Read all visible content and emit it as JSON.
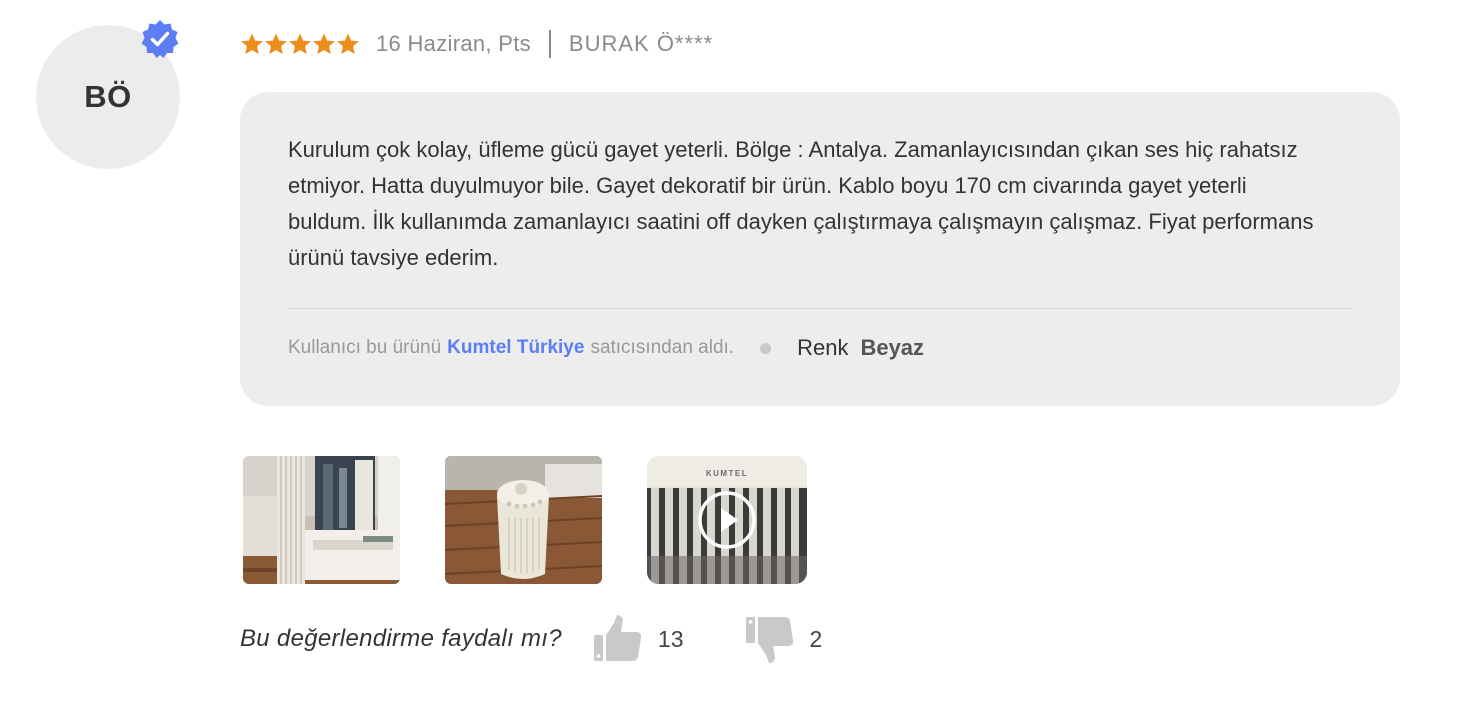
{
  "reviewer": {
    "initials": "BÖ",
    "name": "BURAK Ö****",
    "verified_icon": "verified-badge-icon"
  },
  "review": {
    "rating": 5,
    "max_rating": 5,
    "date": "16 Haziran, Pts",
    "text": "Kurulum çok kolay, üfleme gücü gayet yeterli. Bölge : Antalya. Zamanlayıcısından çıkan ses hiç rahatsız etmiyor. Hatta duyulmuyor bile. Gayet dekoratif bir ürün. Kablo boyu 170 cm civarında gayet yeterli buldum. İlk kullanımda zamanlayıcı saatini off dayken çalıştırmaya çalışmayın çalışmaz. Fiyat performans ürünü tavsiye ederim."
  },
  "seller": {
    "prefix": "Kullanıcı bu ürünü",
    "name": "Kumtel Türkiye",
    "suffix": "satıcısından aldı."
  },
  "attribute": {
    "label": "Renk",
    "value": "Beyaz"
  },
  "media": {
    "video_brand_text": "KUMTEL"
  },
  "helpful": {
    "question": "Bu değerlendirme faydalı mı?",
    "likes": "13",
    "dislikes": "2"
  },
  "colors": {
    "star": "#f28b1e",
    "verified": "#5d7df5",
    "link": "#5d7df5",
    "card_bg": "#ededed",
    "icon_gray": "#c9c9c9"
  }
}
